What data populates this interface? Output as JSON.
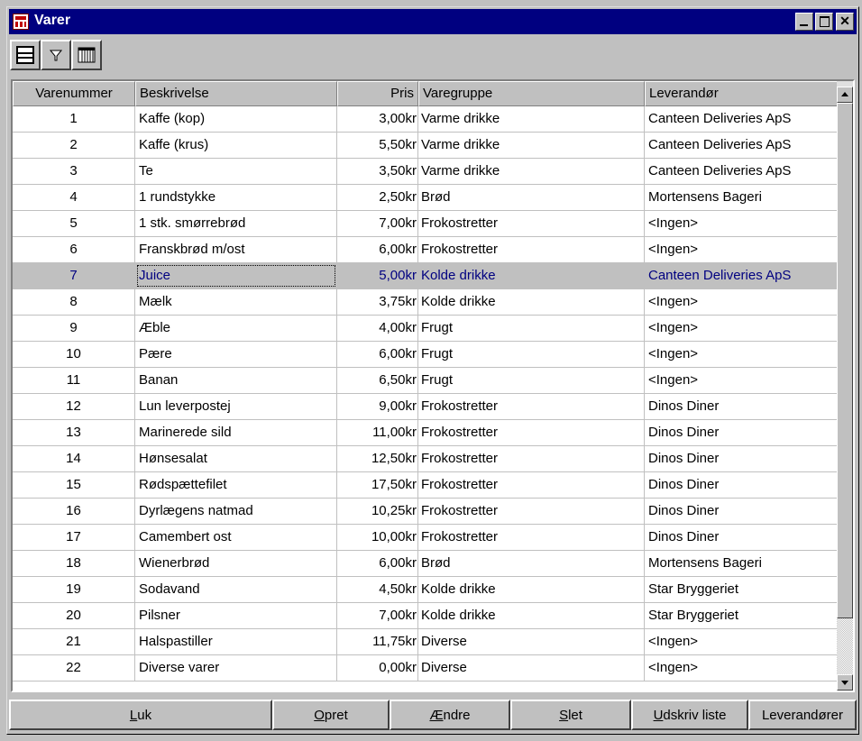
{
  "window": {
    "title": "Varer"
  },
  "toolbar": {
    "buttons": [
      "form-view-icon",
      "filter-icon",
      "table-view-icon"
    ]
  },
  "grid": {
    "columns": [
      "Varenummer",
      "Beskrivelse",
      "Pris",
      "Varegruppe",
      "Leverandør"
    ],
    "rows": [
      [
        "1",
        "Kaffe (kop)",
        "3,00kr",
        "Varme drikke",
        "Canteen Deliveries ApS"
      ],
      [
        "2",
        "Kaffe (krus)",
        "5,50kr",
        "Varme drikke",
        "Canteen Deliveries ApS"
      ],
      [
        "3",
        "Te",
        "3,50kr",
        "Varme drikke",
        "Canteen Deliveries ApS"
      ],
      [
        "4",
        "1 rundstykke",
        "2,50kr",
        "Brød",
        "Mortensens Bageri"
      ],
      [
        "5",
        "1 stk. smørrebrød",
        "7,00kr",
        "Frokostretter",
        "<Ingen>"
      ],
      [
        "6",
        "Franskbrød m/ost",
        "6,00kr",
        "Frokostretter",
        "<Ingen>"
      ],
      [
        "7",
        "Juice",
        "5,00kr",
        "Kolde drikke",
        "Canteen Deliveries ApS"
      ],
      [
        "8",
        "Mælk",
        "3,75kr",
        "Kolde drikke",
        "<Ingen>"
      ],
      [
        "9",
        "Æble",
        "4,00kr",
        "Frugt",
        "<Ingen>"
      ],
      [
        "10",
        "Pære",
        "6,00kr",
        "Frugt",
        "<Ingen>"
      ],
      [
        "11",
        "Banan",
        "6,50kr",
        "Frugt",
        "<Ingen>"
      ],
      [
        "12",
        "Lun leverpostej",
        "9,00kr",
        "Frokostretter",
        "Dinos Diner"
      ],
      [
        "13",
        "Marinerede sild",
        "11,00kr",
        "Frokostretter",
        "Dinos Diner"
      ],
      [
        "14",
        "Hønsesalat",
        "12,50kr",
        "Frokostretter",
        "Dinos Diner"
      ],
      [
        "15",
        "Rødspættefilet",
        "17,50kr",
        "Frokostretter",
        "Dinos Diner"
      ],
      [
        "16",
        "Dyrlægens natmad",
        "10,25kr",
        "Frokostretter",
        "Dinos Diner"
      ],
      [
        "17",
        "Camembert ost",
        "10,00kr",
        "Frokostretter",
        "Dinos Diner"
      ],
      [
        "18",
        "Wienerbrød",
        "6,00kr",
        "Brød",
        "Mortensens Bageri"
      ],
      [
        "19",
        "Sodavand",
        "4,50kr",
        "Kolde drikke",
        "Star Bryggeriet"
      ],
      [
        "20",
        "Pilsner",
        "7,00kr",
        "Kolde drikke",
        "Star Bryggeriet"
      ],
      [
        "21",
        "Halspastiller",
        "11,75kr",
        "Diverse",
        "<Ingen>"
      ],
      [
        "22",
        "Diverse varer",
        "0,00kr",
        "Diverse",
        "<Ingen>"
      ]
    ],
    "selected_row": 6
  },
  "buttons": {
    "close": {
      "first": "L",
      "rest": "uk",
      "label": "Luk"
    },
    "create": {
      "first": "O",
      "rest": "pret",
      "label": "Opret"
    },
    "edit": {
      "first": "Æ",
      "rest": "ndre",
      "label": "Ændre"
    },
    "delete": {
      "first": "S",
      "rest": "let",
      "label": "Slet"
    },
    "print": {
      "first": "U",
      "rest": "dskriv liste",
      "label": "Udskriv liste"
    },
    "suppliers": {
      "label": "Leverandører"
    }
  },
  "colors": {
    "titlebar": "#000080",
    "selected_text": "#000080",
    "face": "#c0c0c0"
  }
}
